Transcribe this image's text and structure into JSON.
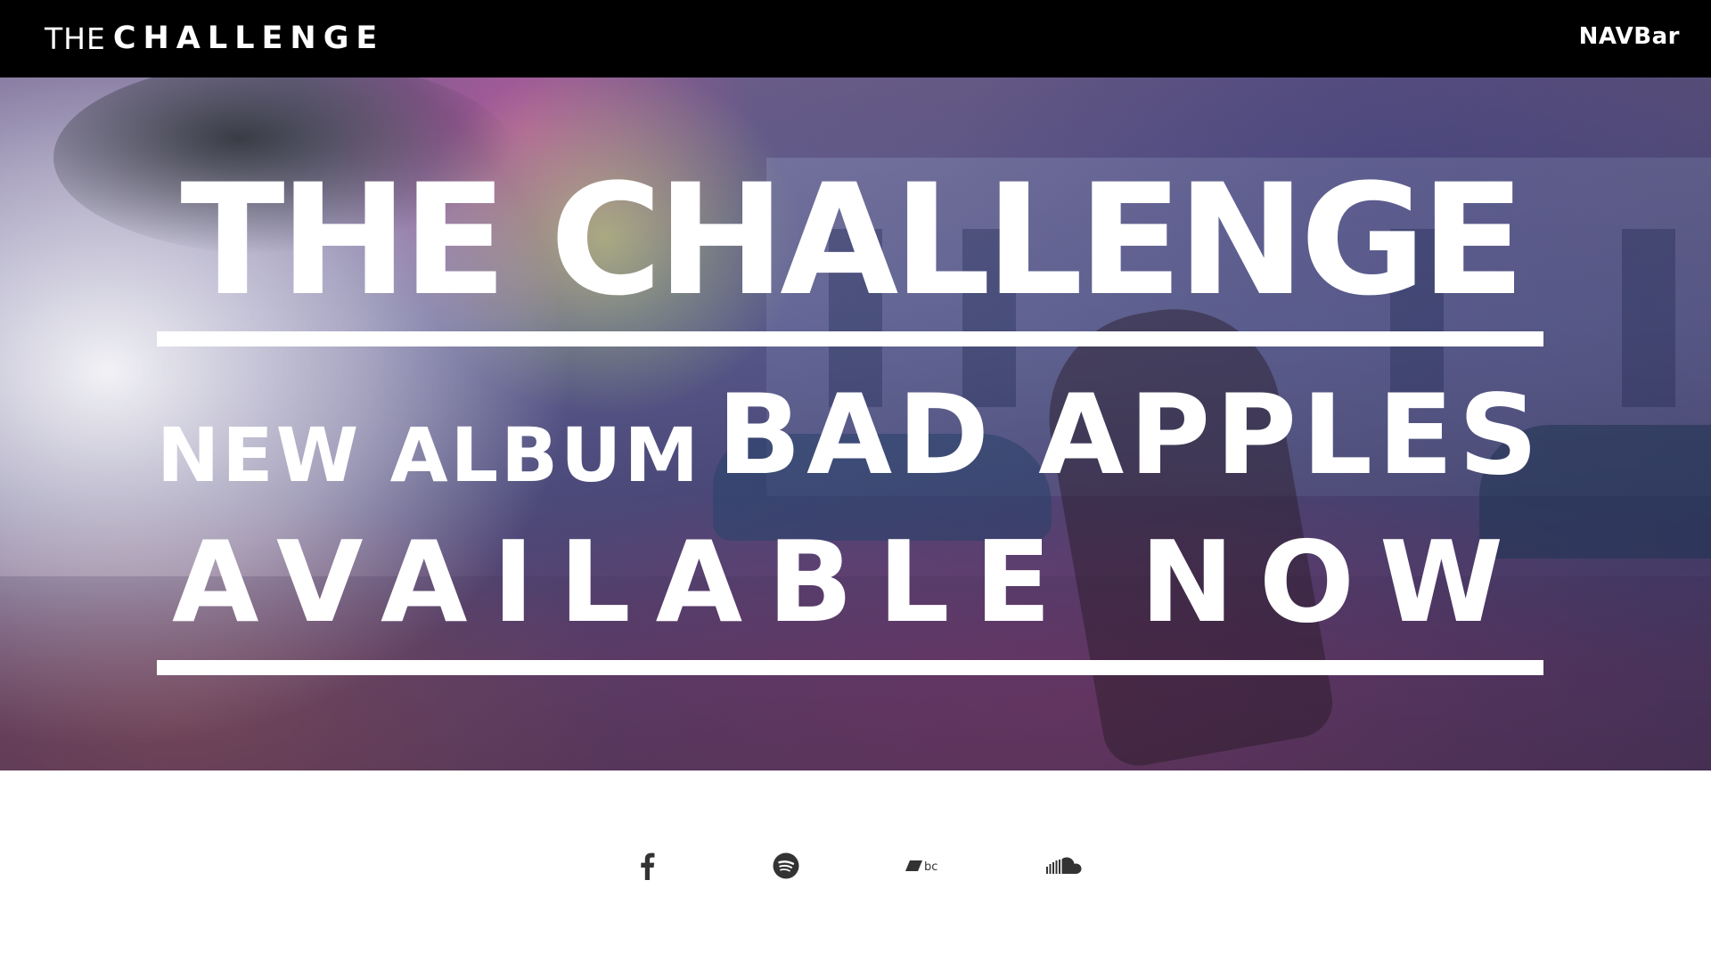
{
  "header": {
    "brand_prefix": "THE",
    "brand_name": "CHALLENGE",
    "nav_label": "NAVBar"
  },
  "hero": {
    "title": "THE CHALLENGE",
    "new_album_label": "NEW ALBUM",
    "album_name": "BAD APPLES",
    "availability": "AVAILABLE NOW"
  },
  "social": {
    "items": [
      {
        "icon": "facebook-icon"
      },
      {
        "icon": "spotify-icon"
      },
      {
        "icon": "bandcamp-icon",
        "glyph_text": "bc"
      },
      {
        "icon": "soundcloud-icon"
      }
    ],
    "icon_color": "#333333"
  },
  "colors": {
    "topbar_bg": "#000000",
    "text_on_dark": "#ffffff",
    "page_bg": "#ffffff"
  }
}
